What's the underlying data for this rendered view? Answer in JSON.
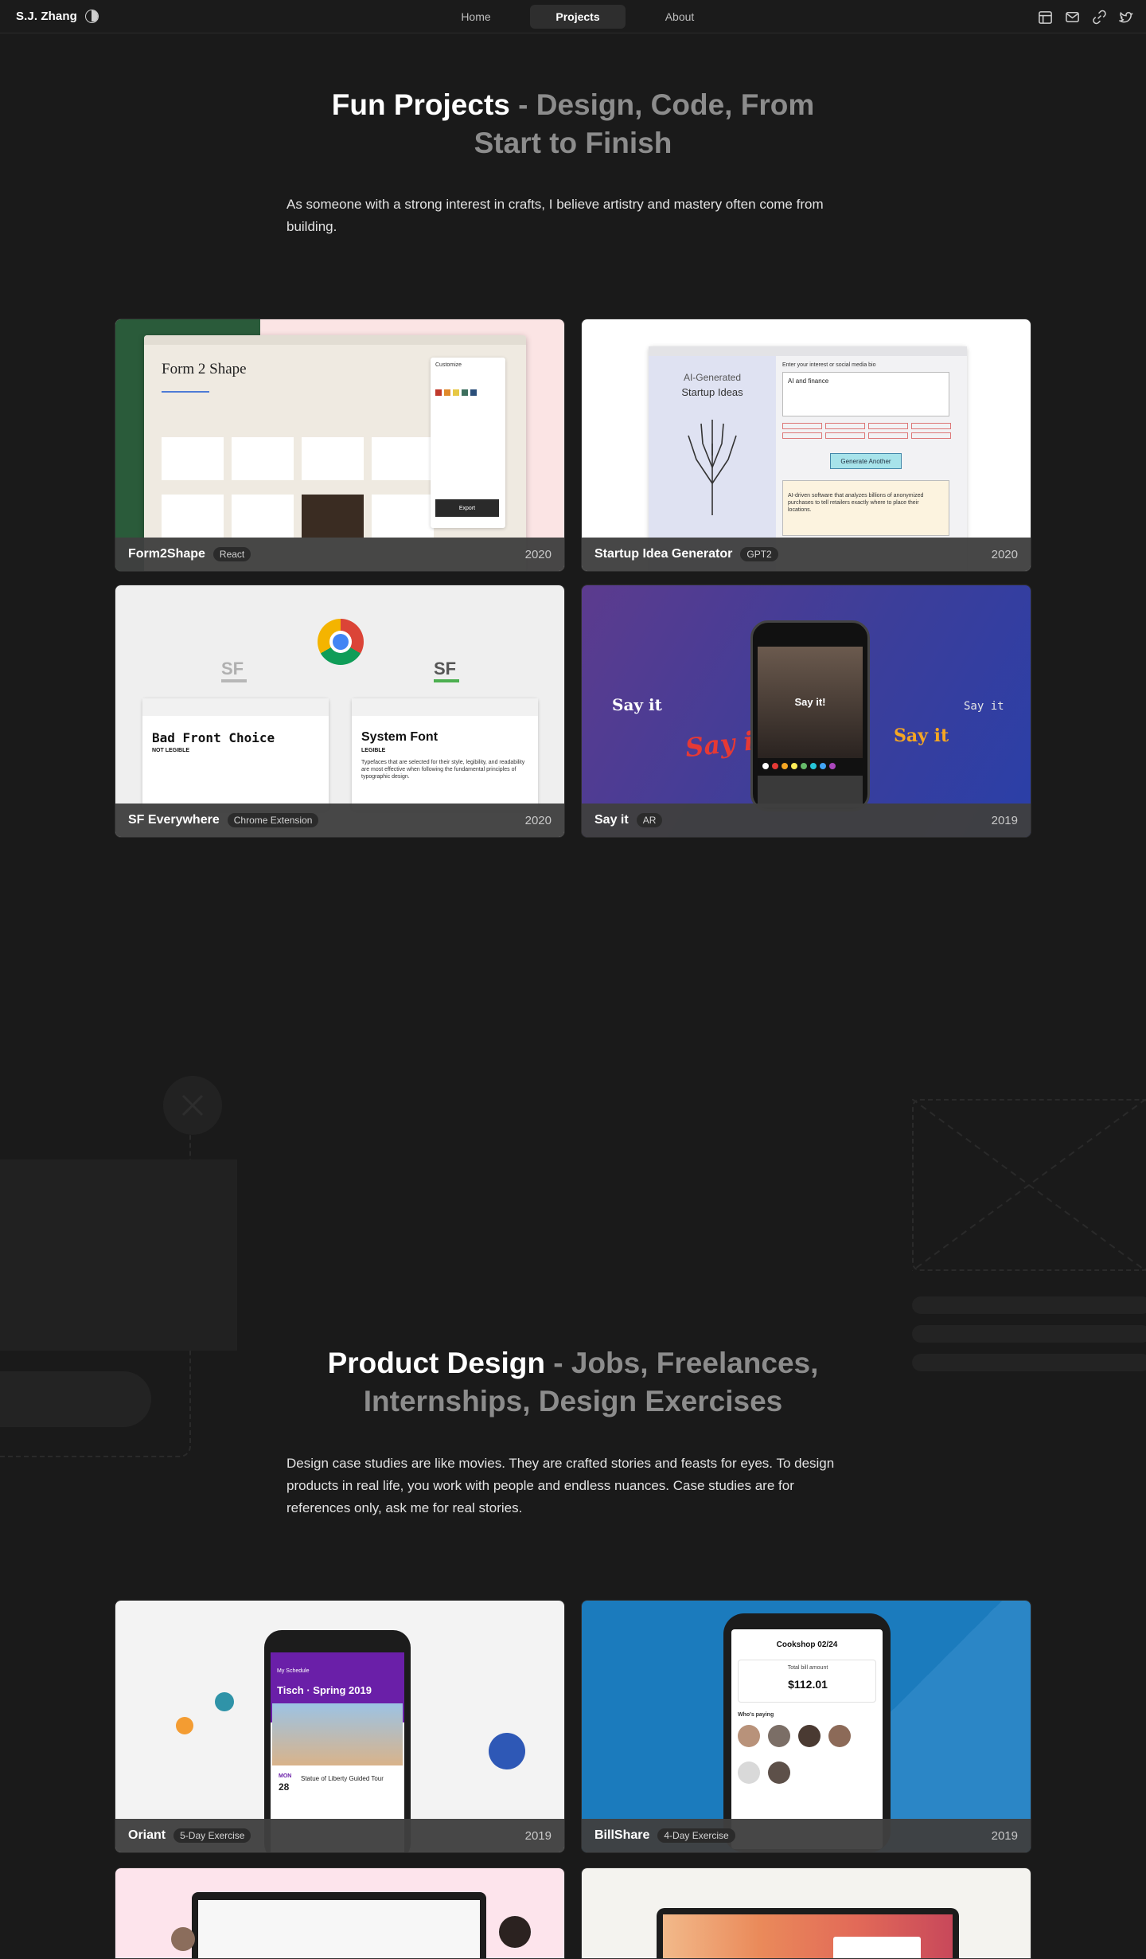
{
  "nav": {
    "brand": "S.J. Zhang",
    "tabs": [
      {
        "label": "Home",
        "active": false
      },
      {
        "label": "Projects",
        "active": true
      },
      {
        "label": "About",
        "active": false
      }
    ],
    "icons": [
      "calendar-icon",
      "mail-icon",
      "link-icon",
      "twitter-icon"
    ]
  },
  "fun": {
    "title_main": "Fun Projects",
    "title_sub_line1": " - Design, Code, From",
    "title_sub_line2": "Start to Finish",
    "intro": "As someone with a strong interest in crafts, I believe artistry and mastery often come from building.",
    "projects": [
      {
        "title": "Form2Shape",
        "tag": "React",
        "year": "2020",
        "art": {
          "heading": "Form 2 Shape",
          "customize": "Customize",
          "export": "Export"
        }
      },
      {
        "title": "Startup Idea Generator",
        "tag": "GPT2",
        "year": "2020",
        "art": {
          "heading1": "AI-Generated",
          "heading2": "Startup Ideas",
          "prompt": "Enter your interest or social media bio",
          "input": "AI and finance",
          "button": "Generate Another",
          "result": "AI-driven software that analyzes billions of anonymized purchases to tell retailers exactly where to place their locations."
        }
      },
      {
        "title": "SF Everywhere",
        "tag": "Chrome Extension",
        "year": "2020",
        "art": {
          "sf": "SF",
          "left_title": "Bad Front Choice",
          "left_sub": "NOT LEGIBLE",
          "right_title": "System Font",
          "right_sub": "LEGIBLE",
          "right_body": "Typefaces that are selected for their style, legibility, and readability are most effective when following the fundamental principles of typographic design."
        }
      },
      {
        "title": "Say it",
        "tag": "AR",
        "year": "2019",
        "art": {
          "say1": "Say it",
          "say2": "Say it",
          "say3": "Say it",
          "say4": "Say it",
          "say_center": "Say it!"
        }
      }
    ]
  },
  "product": {
    "title_main": "Product Design",
    "title_sub_line1": " - Jobs, Freelances,",
    "title_sub_line2": "Internships, Design Exercises",
    "intro": "Design case studies are like movies. They are crafted stories and feasts for eyes. To design products in real life, you work with people and endless nuances. Case studies are for references only, ask me for real stories.",
    "projects": [
      {
        "title": "Oriant",
        "tag": "5-Day Exercise",
        "year": "2019",
        "art": {
          "schedule": "My Schedule",
          "heading": "Tisch · Spring 2019",
          "event": "Statue of Liberty Guided Tour",
          "day": "MON",
          "date": "28"
        }
      },
      {
        "title": "BillShare",
        "tag": "4-Day Exercise",
        "year": "2019",
        "art": {
          "header": "Cookshop 02/24",
          "label": "Total bill amount",
          "amount": "$112.01",
          "paying": "Who's paying"
        }
      }
    ]
  },
  "colors": {
    "bg": "#1a1a1a",
    "form2shape_green": "#2a5b3a",
    "startup_bg": "#ffffff",
    "sayit_purple": "#4b3d8c",
    "billshare_blue": "#1b7bbd",
    "oriant_purple": "#6a1fa8"
  }
}
